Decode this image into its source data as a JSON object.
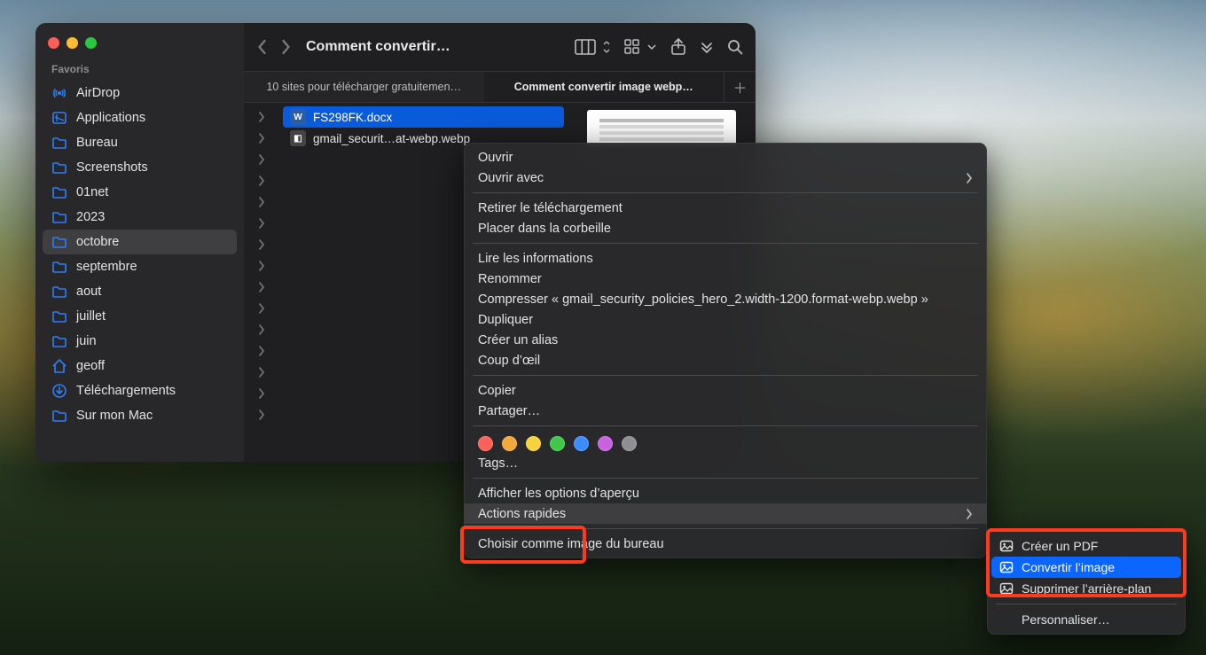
{
  "sidebar": {
    "heading": "Favoris",
    "items": [
      {
        "label": "AirDrop",
        "icon": "airdrop"
      },
      {
        "label": "Applications",
        "icon": "apps"
      },
      {
        "label": "Bureau",
        "icon": "folder"
      },
      {
        "label": "Screenshots",
        "icon": "folder"
      },
      {
        "label": "01net",
        "icon": "folder"
      },
      {
        "label": "2023",
        "icon": "folder"
      },
      {
        "label": "octobre",
        "icon": "folder",
        "selected": true
      },
      {
        "label": "septembre",
        "icon": "folder"
      },
      {
        "label": "aout",
        "icon": "folder"
      },
      {
        "label": "juillet",
        "icon": "folder"
      },
      {
        "label": "juin",
        "icon": "folder"
      },
      {
        "label": "geoff",
        "icon": "home"
      },
      {
        "label": "Téléchargements",
        "icon": "download"
      },
      {
        "label": "Sur mon Mac",
        "icon": "folder"
      }
    ]
  },
  "toolbar": {
    "title": "Comment convertir…"
  },
  "tabs": [
    {
      "label": "10 sites pour télécharger gratuitemen…",
      "active": false
    },
    {
      "label": "Comment convertir image webp…",
      "active": true
    }
  ],
  "files": [
    {
      "name": "FS298FK.docx",
      "type": "docx",
      "selected": true
    },
    {
      "name": "gmail_securit…at-webp.webp",
      "type": "webp",
      "selected": false
    }
  ],
  "context_menu": {
    "groups": [
      [
        {
          "label": "Ouvrir"
        },
        {
          "label": "Ouvrir avec",
          "submenu": true
        }
      ],
      [
        {
          "label": "Retirer le téléchargement"
        },
        {
          "label": "Placer dans la corbeille"
        }
      ],
      [
        {
          "label": "Lire les informations"
        },
        {
          "label": "Renommer"
        },
        {
          "label": "Compresser « gmail_security_policies_hero_2.width-1200.format-webp.webp »"
        },
        {
          "label": "Dupliquer"
        },
        {
          "label": "Créer un alias"
        },
        {
          "label": "Coup d’œil"
        }
      ],
      [
        {
          "label": "Copier"
        },
        {
          "label": "Partager…"
        }
      ]
    ],
    "tag_colors": [
      "#ff6058",
      "#f4a83a",
      "#f6d33c",
      "#3fc94a",
      "#3b8cff",
      "#c862e0",
      "#8e8e93"
    ],
    "tags_label": "Tags…",
    "after_tags": [
      {
        "label": "Afficher les options d’aperçu"
      },
      {
        "label": "Actions rapides",
        "submenu": true,
        "hover": true
      },
      {
        "label": "Choisir comme image du bureau"
      }
    ]
  },
  "submenu": {
    "items": [
      {
        "label": "Créer un PDF",
        "icon": "pdf"
      },
      {
        "label": "Convertir l’image",
        "icon": "convert",
        "selected": true
      },
      {
        "label": "Supprimer l’arrière-plan",
        "icon": "removebg"
      }
    ],
    "customize": "Personnaliser…"
  }
}
